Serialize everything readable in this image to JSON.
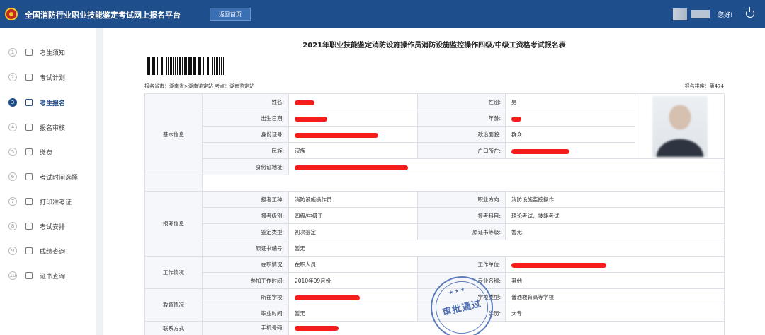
{
  "header": {
    "app_title": "全国消防行业职业技能鉴定考试网上报名平台",
    "home_button": "返回首页",
    "greeting": "您好!"
  },
  "sidebar": {
    "items": [
      {
        "num": "1",
        "label": "考生须知",
        "icon": "home-icon",
        "active": false
      },
      {
        "num": "2",
        "label": "考试计划",
        "icon": "document-icon",
        "active": false
      },
      {
        "num": "3",
        "label": "考生报名",
        "icon": "edit-icon",
        "active": true
      },
      {
        "num": "4",
        "label": "报名审核",
        "icon": "document-search-icon",
        "active": false
      },
      {
        "num": "5",
        "label": "缴费",
        "icon": "payment-icon",
        "active": false
      },
      {
        "num": "6",
        "label": "考试时间选择",
        "icon": "alarm-clock-icon",
        "active": false
      },
      {
        "num": "7",
        "label": "打印准考证",
        "icon": "printer-icon",
        "active": false
      },
      {
        "num": "8",
        "label": "考试安排",
        "icon": "calendar-icon",
        "active": false
      },
      {
        "num": "9",
        "label": "成绩查询",
        "icon": "search-icon",
        "active": false
      },
      {
        "num": "10",
        "label": "证书查询",
        "icon": "certificate-icon",
        "active": false
      }
    ]
  },
  "form": {
    "title": "2021年职业技能鉴定消防设施操作员消防设施监控操作四级/中级工资格考试报名表",
    "meta_left": "报名省市：湖南省>湖南鉴定站   考点：湖南鉴定站",
    "meta_right": "报名排序：第474",
    "sections": {
      "basic": "基本信息",
      "exam": "报考信息",
      "work": "工作情况",
      "edu": "教育情况",
      "contact": "联系方式"
    },
    "labels": {
      "name": "姓名:",
      "gender": "性别:",
      "birth": "出生日期:",
      "age": "年龄:",
      "id_no": "身份证号:",
      "political": "政治面貌:",
      "ethnic": "民族:",
      "hukou": "户口所在:",
      "id_addr": "身份证地址:",
      "job_type": "报考工种:",
      "direction": "职业方向:",
      "level": "报考级别:",
      "subject": "报考科目:",
      "appraisal": "鉴定类型:",
      "orig_level": "原证书等级:",
      "orig_cert": "原证书编号:",
      "employ": "在职情况:",
      "employer": "工作单位:",
      "work_start": "参加工作时间:",
      "major": "专业名称:",
      "school": "所在学校:",
      "school_type": "学校类型:",
      "grad_time": "毕业时间:",
      "degree": "学历:",
      "phone": "手机号码:"
    },
    "values": {
      "gender": "男",
      "political": "群众",
      "ethnic": "汉族",
      "job_type": "消防设施操作员",
      "direction": "消防设施监控操作",
      "level": "四级/中级工",
      "subject": "理论考试、技能考试",
      "appraisal": "初次鉴定",
      "orig_level": "暂无",
      "orig_cert": "暂无",
      "employ": "在职人员",
      "work_start": "2010年09月份",
      "major": "其他",
      "school_type": "普通教育高等学校",
      "grad_time": "暂无",
      "degree": "大专"
    },
    "stamp_text": "审批通过",
    "stamp_stars": "★★★"
  },
  "colors": {
    "header_bg": "#1f4e8c",
    "redaction": "#f51c1c",
    "stamp": "#3d5fa8"
  }
}
